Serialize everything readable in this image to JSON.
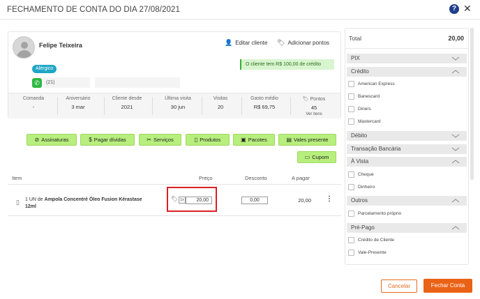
{
  "header": {
    "title": "FECHAMENTO DE CONTA DO DIA 27/08/2021",
    "help_icon": "?",
    "close_icon": "✕"
  },
  "client": {
    "name": "Felipe Teixeira",
    "edit_label": "Editar cliente",
    "add_points_label": "Adicionar pontos",
    "allergy_badge": "Alérgico",
    "credit_note": "O cliente tem R$ 100,00 de crédito",
    "phone": "(21)",
    "stats": [
      {
        "label": "Comanda",
        "value": "-"
      },
      {
        "label": "Aniversário",
        "value": "3 mar"
      },
      {
        "label": "Cliente desde",
        "value": "2021"
      },
      {
        "label": "Última visita",
        "value": "30 jun"
      },
      {
        "label": "Visitas",
        "value": "20"
      },
      {
        "label": "Gasto médio",
        "value": "R$ 69,75"
      },
      {
        "label": "Pontos",
        "value": "45",
        "sub": "Ver itens"
      }
    ]
  },
  "actions": {
    "assinaturas": "Assinaturas",
    "pagar_dividas": "Pagar dívidas",
    "servicos": "Serviços",
    "produtos": "Produtos",
    "pacotes": "Pacotes",
    "vales_presente": "Vales presente",
    "cupom": "Cupom"
  },
  "table": {
    "headers": {
      "item": "Item",
      "preco": "Preço",
      "desconto": "Desconto",
      "a_pagar": "A pagar"
    },
    "rows": [
      {
        "qty_prefix": "1 UN de",
        "name": "Ampola Concentré Óleo Fusion Kérastase 12ml",
        "qty_badge": "1x",
        "price": "20,00",
        "discount": "0,00",
        "to_pay": "20,00"
      }
    ]
  },
  "payment": {
    "total_label": "Total",
    "total_value": "20,00",
    "sections": {
      "pix": "PIX",
      "credito": "Crédito",
      "debito": "Débito",
      "transacao": "Transação Bancária",
      "a_vista": "À Vista",
      "outros": "Outros",
      "pre_pago": "Pré-Pago"
    },
    "credito_options": [
      "American Express",
      "Banescard",
      "Diners",
      "Mastercard"
    ],
    "a_vista_options": [
      "Cheque",
      "Dinheiro"
    ],
    "outros_options": [
      "Parcelamento próprio"
    ],
    "pre_pago_options": [
      "Crédito de Cliente",
      "Vale-Presente"
    ]
  },
  "footer": {
    "cancel_label": "Cancelar",
    "close_account_label": "Fechar Conta"
  },
  "colors": {
    "accent_orange": "#ea6216",
    "action_green": "#b7ee7d",
    "allergy_blue": "#1fa6c7",
    "highlight_red": "#d92121"
  }
}
